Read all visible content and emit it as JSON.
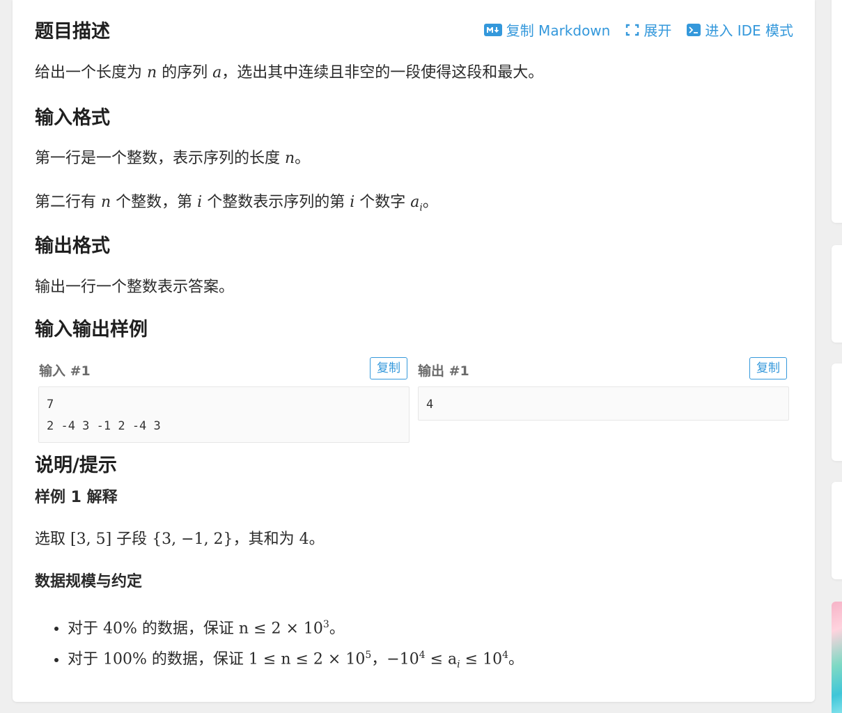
{
  "toolbar": {
    "copy_markdown": "复制 Markdown",
    "expand": "展开",
    "ide_mode": "进入 IDE 模式"
  },
  "description": {
    "title": "题目描述",
    "text_1": "给出一个长度为 ",
    "var_n": "n",
    "text_2": " 的序列 ",
    "var_a": "a",
    "text_3": "，选出其中连续且非空的一段使得这段和最大。"
  },
  "input_format": {
    "title": "输入格式",
    "line1_a": "第一行是一个整数，表示序列的长度 ",
    "line1_var": "n",
    "line1_b": "。",
    "line2_a": "第二行有 ",
    "line2_var_n": "n",
    "line2_b": " 个整数，第 ",
    "line2_var_i": "i",
    "line2_c": " 个整数表示序列的第 ",
    "line2_var_i2": "i",
    "line2_d": " 个数字 ",
    "line2_var_a": "a",
    "line2_sub_i": "i",
    "line2_e": "。"
  },
  "output_format": {
    "title": "输出格式",
    "text": "输出一行一个整数表示答案。"
  },
  "samples": {
    "title": "输入输出样例",
    "input_label": "输入 #1",
    "output_label": "输出 #1",
    "copy_label": "复制",
    "input_text": "7\n2 -4 3 -1 2 -4 3",
    "output_text": "4"
  },
  "hint": {
    "title": "说明/提示",
    "sample_explain_title": "样例 1 解释",
    "explain_a": "选取 ",
    "explain_interval": "[3, 5]",
    "explain_b": " 子段 ",
    "explain_set": "{3, −1, 2}",
    "explain_c": "，其和为 ",
    "explain_val": "4",
    "explain_d": "。",
    "constraints_title": "数据规模与约定",
    "c1_a": "对于 ",
    "c1_pct": "40%",
    "c1_b": " 的数据，保证 ",
    "c1_math": "n ≤ 2 × 10",
    "c1_exp": "3",
    "c1_c": "。",
    "c2_a": "对于 ",
    "c2_pct": "100%",
    "c2_b": " 的数据，保证 ",
    "c2_math1": "1 ≤ n ≤ 2 × 10",
    "c2_exp1": "5",
    "c2_sep": "，",
    "c2_math2": "−10",
    "c2_exp2": "4",
    "c2_math3": " ≤ a",
    "c2_sub": "i",
    "c2_math4": " ≤ 10",
    "c2_exp3": "4",
    "c2_c": "。"
  },
  "colors": {
    "accent": "#3498db",
    "text": "#262626",
    "background": "#efefef"
  }
}
